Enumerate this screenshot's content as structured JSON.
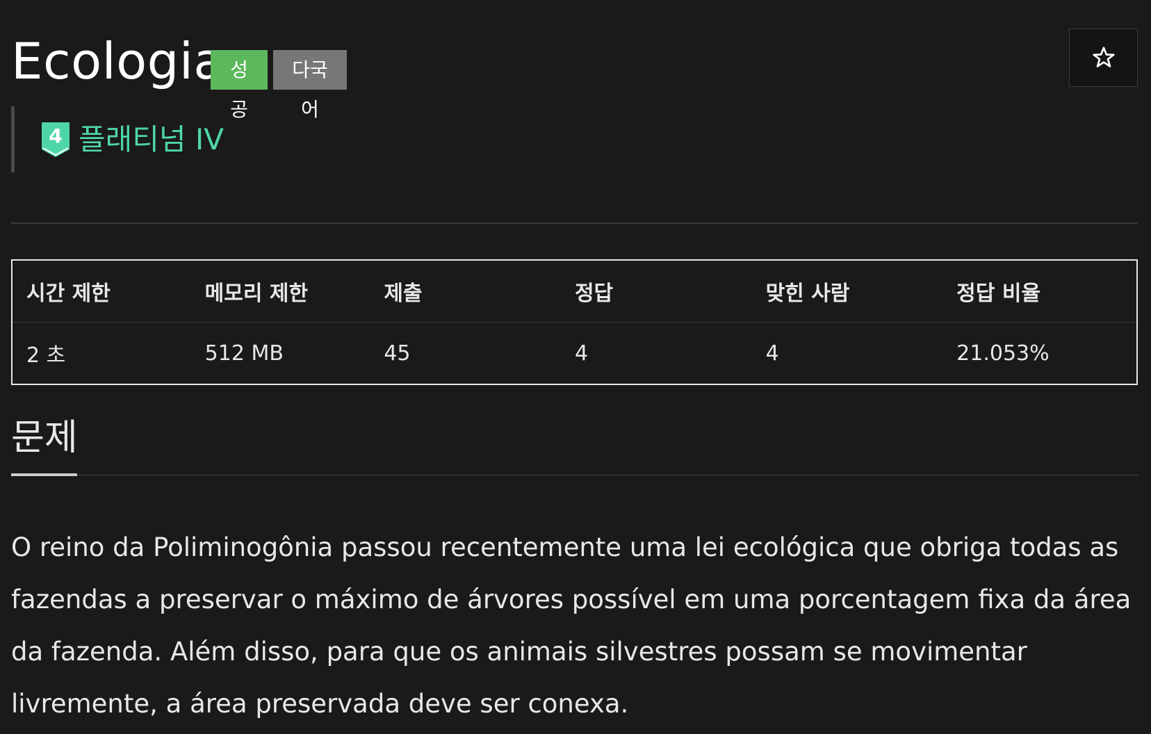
{
  "header": {
    "title": "Ecologia",
    "badge_success": "성공",
    "badge_multilang": "다국어",
    "favorite_icon": "star-icon"
  },
  "tier": {
    "number": "4",
    "label": "플래티넘 IV",
    "icon": "platinum-tier-icon",
    "color": "#4fd6a8"
  },
  "limits": {
    "headers": [
      "시간 제한",
      "메모리 제한",
      "제출",
      "정답",
      "맞힌 사람",
      "정답 비율"
    ],
    "values": [
      "2 초",
      "512 MB",
      "45",
      "4",
      "4",
      "21.053%"
    ]
  },
  "problem": {
    "section_title": "문제",
    "description": "O reino da Poliminogônia passou recentemente uma lei ecológica que obriga todas as fazendas a preservar o máximo de árvores possível em uma porcentagem fixa da área da fazenda. Além disso, para que os animais silvestres possam se movimentar livremente, a área preservada deve ser conexa."
  },
  "colors": {
    "background": "#1a1a1a",
    "success": "#5cb85c",
    "multilang": "#777777",
    "tier": "#4fd6a8"
  }
}
